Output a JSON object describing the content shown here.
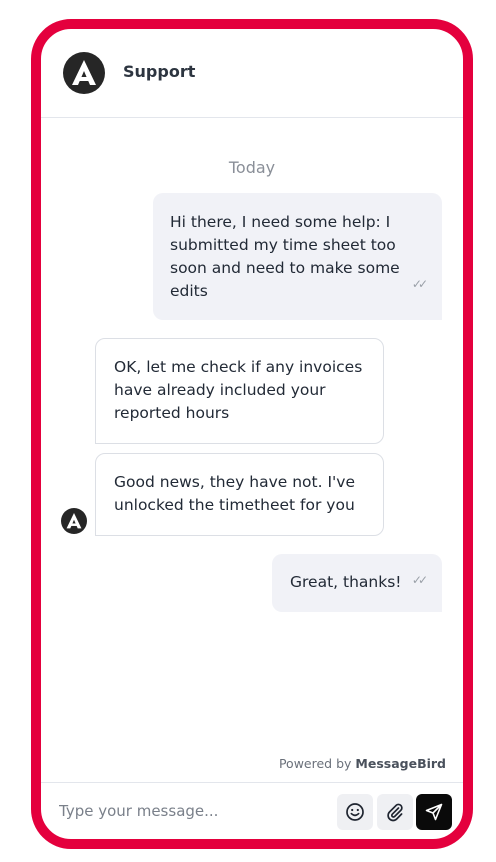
{
  "header": {
    "title": "Support",
    "logo_icon": "brand-a-logo-icon"
  },
  "conversation": {
    "day_separator": "Today",
    "messages": [
      {
        "direction": "outgoing",
        "text": "Hi there, I need some help: I submitted my time sheet too soon and need to make some edits",
        "status_icon": "double-check-icon"
      },
      {
        "direction": "incoming",
        "text": "OK, let me check if any invoices have already included your reported hours"
      },
      {
        "direction": "incoming",
        "text": "Good news, they have not. I've unlocked the timetheet for you"
      },
      {
        "direction": "outgoing",
        "text": "Great, thanks!",
        "status_icon": "double-check-icon"
      }
    ]
  },
  "footer": {
    "powered_prefix": "Powered by",
    "powered_brand": "MessageBird"
  },
  "composer": {
    "placeholder": "Type your message...",
    "value": "",
    "emoji_icon": "emoji-icon",
    "attach_icon": "paperclip-icon",
    "send_icon": "send-icon"
  },
  "colors": {
    "frame": "#e4003d",
    "outgoing_bubble": "#f1f2f7",
    "send_button": "#0a0a0a"
  }
}
